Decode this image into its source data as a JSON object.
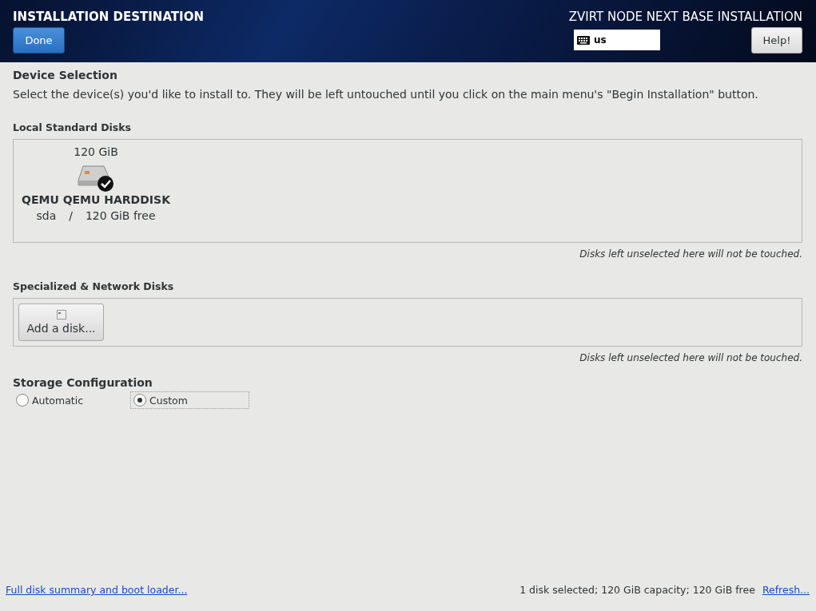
{
  "header": {
    "title": "INSTALLATION DESTINATION",
    "done_button": "Done",
    "product": "ZVIRT NODE NEXT BASE INSTALLATION",
    "keyboard_layout": "us",
    "help_button": "Help!"
  },
  "device_selection": {
    "heading": "Device Selection",
    "description": "Select the device(s) you'd like to install to.  They will be left untouched until you click on the main menu's \"Begin Installation\" button."
  },
  "local_disks": {
    "heading": "Local Standard Disks",
    "disks": [
      {
        "size": "120 GiB",
        "name": "QEMU QEMU HARDDISK",
        "device": "sda",
        "separator": "/",
        "free": "120 GiB free",
        "selected": true
      }
    ],
    "note": "Disks left unselected here will not be touched."
  },
  "network_disks": {
    "heading": "Specialized & Network Disks",
    "add_button": "Add a disk...",
    "note": "Disks left unselected here will not be touched."
  },
  "storage": {
    "heading": "Storage Configuration",
    "options": [
      {
        "label": "Automatic",
        "selected": false
      },
      {
        "label": "Custom",
        "selected": true
      }
    ]
  },
  "footer": {
    "summary_link": "Full disk summary and boot loader...",
    "status": "1 disk selected; 120 GiB capacity; 120 GiB free",
    "refresh_link": "Refresh..."
  }
}
